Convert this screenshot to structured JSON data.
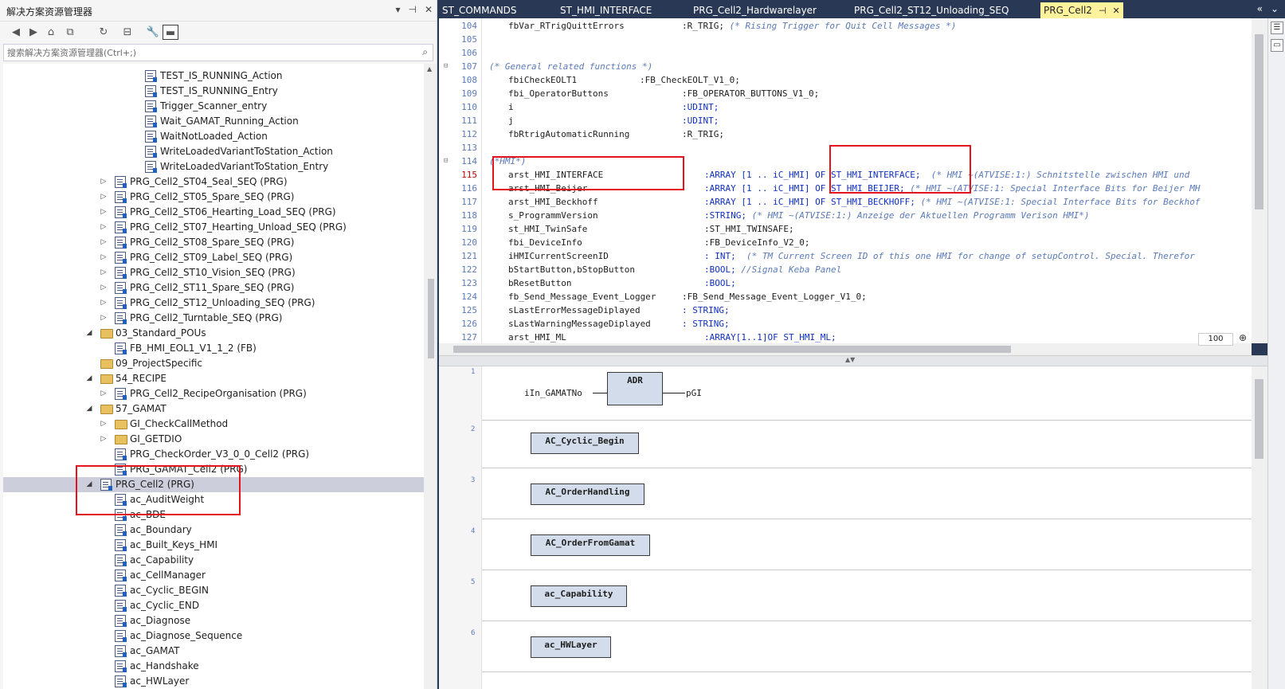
{
  "solution_explorer": {
    "title": "解决方案资源管理器",
    "title_buttons": [
      "▾",
      "⊣",
      "✕"
    ],
    "search_placeholder": "搜索解决方案资源管理器(Ctrl+;)",
    "tree": [
      {
        "label": "TEST_IS_RUNNING_Action",
        "kind": "doc"
      },
      {
        "label": "TEST_IS_RUNNING_Entry",
        "kind": "doc"
      },
      {
        "label": "Trigger_Scanner_entry",
        "kind": "doc"
      },
      {
        "label": "Wait_GAMAT_Running_Action",
        "kind": "doc"
      },
      {
        "label": "WaitNotLoaded_Action",
        "kind": "doc"
      },
      {
        "label": "WriteLoadedVariantToStation_Action",
        "kind": "doc"
      },
      {
        "label": "WriteLoadedVariantToStation_Entry",
        "kind": "doc"
      },
      {
        "label": "PRG_Cell2_ST04_Seal_SEQ (PRG)",
        "kind": "doc",
        "arrow": "▷"
      },
      {
        "label": "PRG_Cell2_ST05_Spare_SEQ (PRG)",
        "kind": "doc",
        "arrow": "▷"
      },
      {
        "label": "PRG_Cell2_ST06_Hearting_Load_SEQ (PRG)",
        "kind": "doc",
        "arrow": "▷"
      },
      {
        "label": "PRG_Cell2_ST07_Hearting_Unload_SEQ (PRG)",
        "kind": "doc",
        "arrow": "▷"
      },
      {
        "label": "PRG_Cell2_ST08_Spare_SEQ (PRG)",
        "kind": "doc",
        "arrow": "▷"
      },
      {
        "label": "PRG_Cell2_ST09_Label_SEQ (PRG)",
        "kind": "doc",
        "arrow": "▷"
      },
      {
        "label": "PRG_Cell2_ST10_Vision_SEQ (PRG)",
        "kind": "doc",
        "arrow": "▷"
      },
      {
        "label": "PRG_Cell2_ST11_Spare_SEQ (PRG)",
        "kind": "doc",
        "arrow": "▷"
      },
      {
        "label": "PRG_Cell2_ST12_Unloading_SEQ (PRG)",
        "kind": "doc",
        "arrow": "▷"
      },
      {
        "label": "PRG_Cell2_Turntable_SEQ (PRG)",
        "kind": "doc",
        "arrow": "▷"
      },
      {
        "label": "03_Standard_POUs",
        "kind": "folder",
        "arrow": "◢"
      },
      {
        "label": "FB_HMI_EOL1_V1_1_2 (FB)",
        "kind": "doc"
      },
      {
        "label": "09_ProjectSpecific",
        "kind": "folder"
      },
      {
        "label": "54_RECIPE",
        "kind": "folder",
        "arrow": "◢"
      },
      {
        "label": "PRG_Cell2_RecipeOrganisation (PRG)",
        "kind": "doc",
        "arrow": "▷"
      },
      {
        "label": "57_GAMAT",
        "kind": "folder",
        "arrow": "◢"
      },
      {
        "label": "GI_CheckCallMethod",
        "kind": "folder",
        "arrow": "▷"
      },
      {
        "label": "GI_GETDIO",
        "kind": "folder",
        "arrow": "▷"
      },
      {
        "label": "PRG_CheckOrder_V3_0_0_Cell2 (PRG)",
        "kind": "doc"
      },
      {
        "label": "PRG_GAMAT_Cell2 (PRG)",
        "kind": "doc"
      },
      {
        "label": "PRG_Cell2 (PRG)",
        "kind": "doc",
        "arrow": "◢",
        "selected": true
      },
      {
        "label": "ac_AuditWeight",
        "kind": "doc"
      },
      {
        "label": "ac_BDE",
        "kind": "doc"
      },
      {
        "label": "ac_Boundary",
        "kind": "doc"
      },
      {
        "label": "ac_Built_Keys_HMI",
        "kind": "doc"
      },
      {
        "label": "ac_Capability",
        "kind": "doc"
      },
      {
        "label": "ac_CellManager",
        "kind": "doc"
      },
      {
        "label": "ac_Cyclic_BEGIN",
        "kind": "doc"
      },
      {
        "label": "ac_Cyclic_END",
        "kind": "doc"
      },
      {
        "label": "ac_Diagnose",
        "kind": "doc"
      },
      {
        "label": "ac_Diagnose_Sequence",
        "kind": "doc"
      },
      {
        "label": "ac_GAMAT",
        "kind": "doc"
      },
      {
        "label": "ac_Handshake",
        "kind": "doc"
      },
      {
        "label": "ac_HWLayer",
        "kind": "doc"
      }
    ]
  },
  "editor_tabs": [
    {
      "label": "ST_COMMANDS"
    },
    {
      "label": "ST_HMI_INTERFACE"
    },
    {
      "label": "PRG_Cell2_Hardwarelayer"
    },
    {
      "label": "PRG_Cell2_ST12_Unloading_SEQ"
    },
    {
      "label": "PRG_Cell2",
      "active": true
    }
  ],
  "code_lines": [
    {
      "n": "104",
      "name": "fbVar_RTrigQuittErrors",
      "type": ":R_TRIG;",
      "comment": " (* Rising Trigger for Quit Cell Messages *)"
    },
    {
      "n": "105",
      "name": "",
      "type": "",
      "comment": ""
    },
    {
      "n": "106",
      "name": "",
      "type": "",
      "comment": ""
    },
    {
      "n": "107",
      "name": "",
      "type": "",
      "comment": "(* General related functions *)",
      "fold": "⊟"
    },
    {
      "n": "108",
      "name": "fbiCheckEOLT1",
      "type": ":FB_CheckEOLT_V1_0;",
      "comment": ""
    },
    {
      "n": "109",
      "name": "fbi_OperatorButtons",
      "type": ":FB_OPERATOR_BUTTONS_V1_0;",
      "comment": ""
    },
    {
      "n": "110",
      "name": "i",
      "type": ":UDINT;",
      "comment": ""
    },
    {
      "n": "111",
      "name": "j",
      "type": ":UDINT;",
      "comment": ""
    },
    {
      "n": "112",
      "name": "fbRtrigAutomaticRunning",
      "type": ":R_TRIG;",
      "comment": ""
    },
    {
      "n": "113",
      "name": "",
      "type": "",
      "comment": ""
    },
    {
      "n": "114",
      "name": "",
      "type": "",
      "comment": "(*HMI*)",
      "fold": "⊟"
    },
    {
      "n": "115",
      "name": "arst_HMI_INTERFACE",
      "type": ":ARRAY [1 .. iC_HMI] OF ST_HMI_INTERFACE;",
      "comment": "  (* HMI ~(ATVISE:1:) Schnitstelle zwischen HMI und",
      "current": true
    },
    {
      "n": "116",
      "name": "arst_HMI_Beijer",
      "type": ":ARRAY [1 .. iC_HMI] OF ST_HMI_BEIJER;",
      "comment": " (* HMI ~(ATVISE:1: Special Interface Bits for Beijer MH"
    },
    {
      "n": "117",
      "name": "arst_HMI_Beckhoff",
      "type": ":ARRAY [1 .. iC_HMI] OF ST_HMI_BECKHOFF;",
      "comment": " (* HMI ~(ATVISE:1: Special Interface Bits for Beckhof"
    },
    {
      "n": "118",
      "name": "s_ProgrammVersion",
      "type": ":STRING;",
      "comment": " (* HMI ~(ATVISE:1:) Anzeige der Aktuellen Programm Verison HMI*)"
    },
    {
      "n": "119",
      "name": "st_HMI_TwinSafe",
      "type": ":ST_HMI_TWINSAFE;",
      "comment": ""
    },
    {
      "n": "120",
      "name": "fbi_DeviceInfo",
      "type": ":FB_DeviceInfo_V2_0;",
      "comment": ""
    },
    {
      "n": "121",
      "name": "iHMICurrentScreenID",
      "type": ": INT;",
      "comment": "  (* TM Current Screen ID of this one HMI for change of setupControl. Special. Therefor"
    },
    {
      "n": "122",
      "name": "bStartButton,bStopButton",
      "type": ":BOOL;",
      "comment": " //Signal Keba Panel"
    },
    {
      "n": "123",
      "name": "bResetButton",
      "type": ":BOOL;",
      "comment": ""
    },
    {
      "n": "124",
      "name": "fb_Send_Message_Event_Logger",
      "type": ":FB_Send_Message_Event_Logger_V1_0;",
      "comment": ""
    },
    {
      "n": "125",
      "name": "sLastErrorMessageDiplayed",
      "type": ": STRING;",
      "comment": ""
    },
    {
      "n": "126",
      "name": "sLastWarningMessageDiplayed",
      "type": ": STRING;",
      "comment": ""
    },
    {
      "n": "127",
      "name": "arst_HMI_ML",
      "type": ":ARRAY[1..1]OF ST_HMI_ML;",
      "comment": ""
    }
  ],
  "zoom": "100",
  "fbd": {
    "networks": [
      {
        "n": "1",
        "input": "iIn_GAMATNo",
        "block": "ADR",
        "output": "pGI"
      },
      {
        "n": "2",
        "block": "AC_Cyclic_Begin"
      },
      {
        "n": "3",
        "block": "AC_OrderHandling"
      },
      {
        "n": "4",
        "block": "AC_OrderFromGamat"
      },
      {
        "n": "5",
        "block": "ac_Capability"
      },
      {
        "n": "6",
        "block": "ac_HWLayer"
      }
    ]
  },
  "colors": {
    "accent_tab": "#fff29d",
    "annotation": "#e4141e",
    "chrome": "#293955"
  }
}
